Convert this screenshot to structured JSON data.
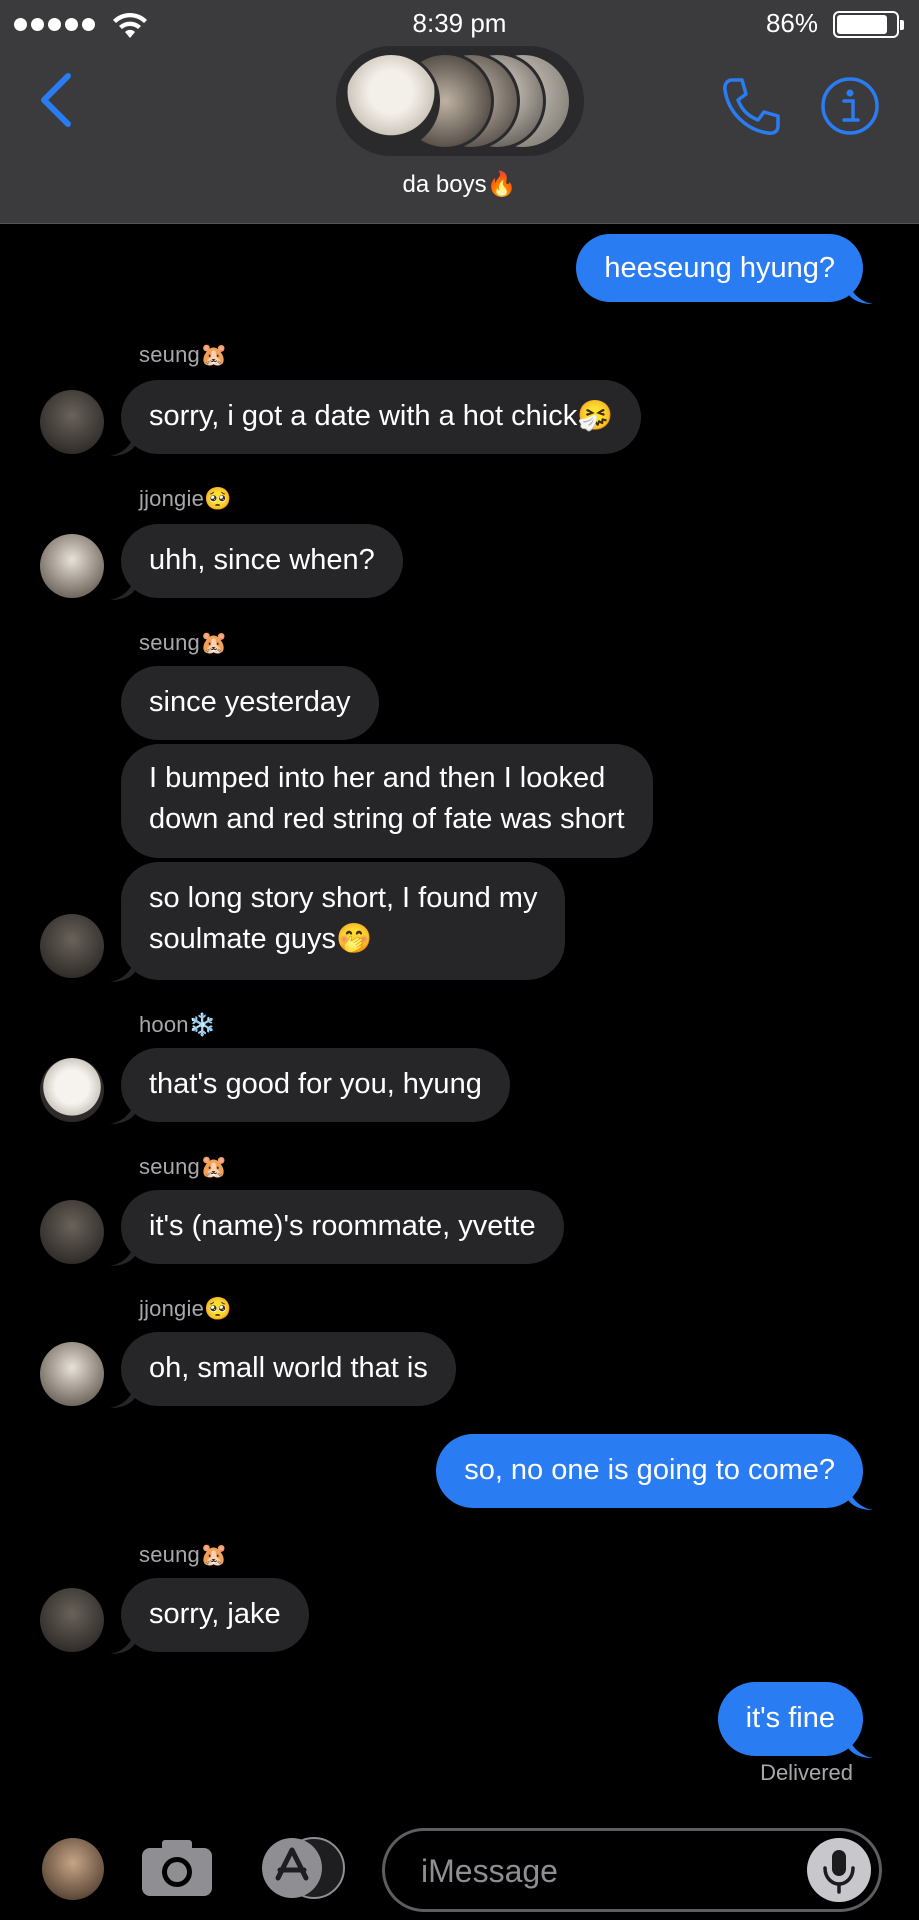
{
  "status": {
    "time": "8:39 pm",
    "battery": "86%"
  },
  "header": {
    "group_name": "da boys",
    "group_emoji": "🔥"
  },
  "messages": [
    {
      "sender": "",
      "text": "heeseung hyung?"
    },
    {
      "sender": "seung",
      "sender_emoji": "🐹",
      "text": "sorry, i got a date with a hot chick",
      "emoji": "🤧"
    },
    {
      "sender": "jjongie",
      "sender_emoji": "🥺",
      "text": "uhh, since when?"
    },
    {
      "sender": "seung",
      "sender_emoji": "🐹",
      "text": "since yesterday"
    },
    {
      "text_line1": "I bumped into her and then I looked",
      "text_line2": "down and red string of fate was short"
    },
    {
      "text_line1": "so long story short, I found my",
      "text_line2": "soulmate guys",
      "emoji": "🤭"
    },
    {
      "sender": "hoon",
      "sender_emoji": "❄️",
      "text": "that's good for you, hyung"
    },
    {
      "sender": "seung",
      "sender_emoji": "🐹",
      "text": "it's (name)'s roommate, yvette"
    },
    {
      "sender": "jjongie",
      "sender_emoji": "🥺",
      "text": "oh, small world that is"
    },
    {
      "text": "so, no one is going to come?"
    },
    {
      "sender": "seung",
      "sender_emoji": "🐹",
      "text": "sorry, jake"
    },
    {
      "text": "it's fine"
    }
  ],
  "delivered": "Delivered",
  "input": {
    "placeholder": "iMessage"
  },
  "colors": {
    "outgoing": "#2a7cf3",
    "incoming": "#262628",
    "accent": "#2a7cf3",
    "header_bg": "#3b3b3d"
  },
  "icons": {
    "back": "chevron-left-icon",
    "call": "phone-icon",
    "info": "info-icon",
    "camera": "camera-icon",
    "apps": "app-store-icon",
    "mic": "microphone-icon"
  }
}
